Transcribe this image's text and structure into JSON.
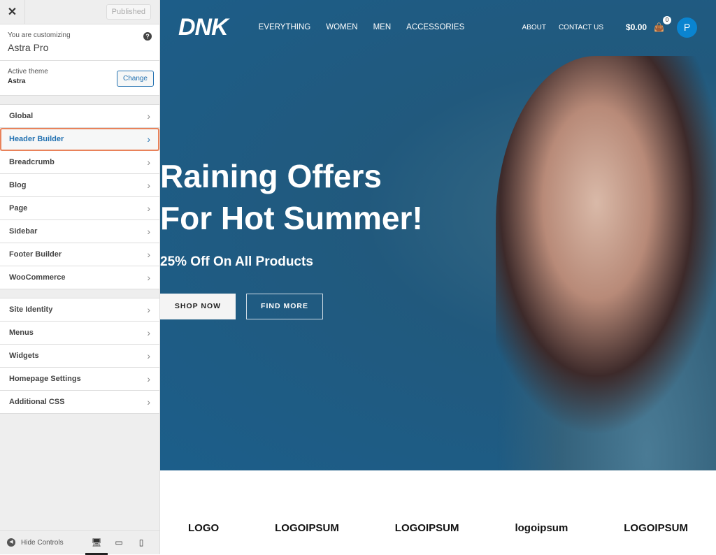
{
  "sidebar": {
    "close": "✕",
    "published": "Published",
    "customizing_label": "You are customizing",
    "site_name": "Astra Pro",
    "help": "?",
    "active_theme_label": "Active theme",
    "theme_name": "Astra",
    "change": "Change",
    "group1": [
      {
        "label": "Global"
      },
      {
        "label": "Header Builder",
        "active": true
      },
      {
        "label": "Breadcrumb"
      },
      {
        "label": "Blog"
      },
      {
        "label": "Page"
      },
      {
        "label": "Sidebar"
      },
      {
        "label": "Footer Builder"
      },
      {
        "label": "WooCommerce"
      }
    ],
    "group2": [
      {
        "label": "Site Identity"
      },
      {
        "label": "Menus"
      },
      {
        "label": "Widgets"
      },
      {
        "label": "Homepage Settings"
      },
      {
        "label": "Additional CSS"
      }
    ],
    "hide_controls": "Hide Controls",
    "accent": "#2271b1",
    "highlight": "#e9825a"
  },
  "preview": {
    "logo": "DNK",
    "menu": [
      "EVERYTHING",
      "WOMEN",
      "MEN",
      "ACCESSORIES"
    ],
    "menu2": [
      "ABOUT",
      "CONTACT US"
    ],
    "price": "$0.00",
    "cart_count": "0",
    "avatar": "P",
    "headline1": "Raining Offers",
    "headline2": "For Hot Summer!",
    "subheadline": "25% Off On All Products",
    "shop_now": "SHOP NOW",
    "find_more": "FIND MORE",
    "logos": [
      "LOGO",
      "LOGOIPSUM",
      "LOGOIPSUM",
      "logoipsum",
      "LOGOIPSUM"
    ]
  }
}
